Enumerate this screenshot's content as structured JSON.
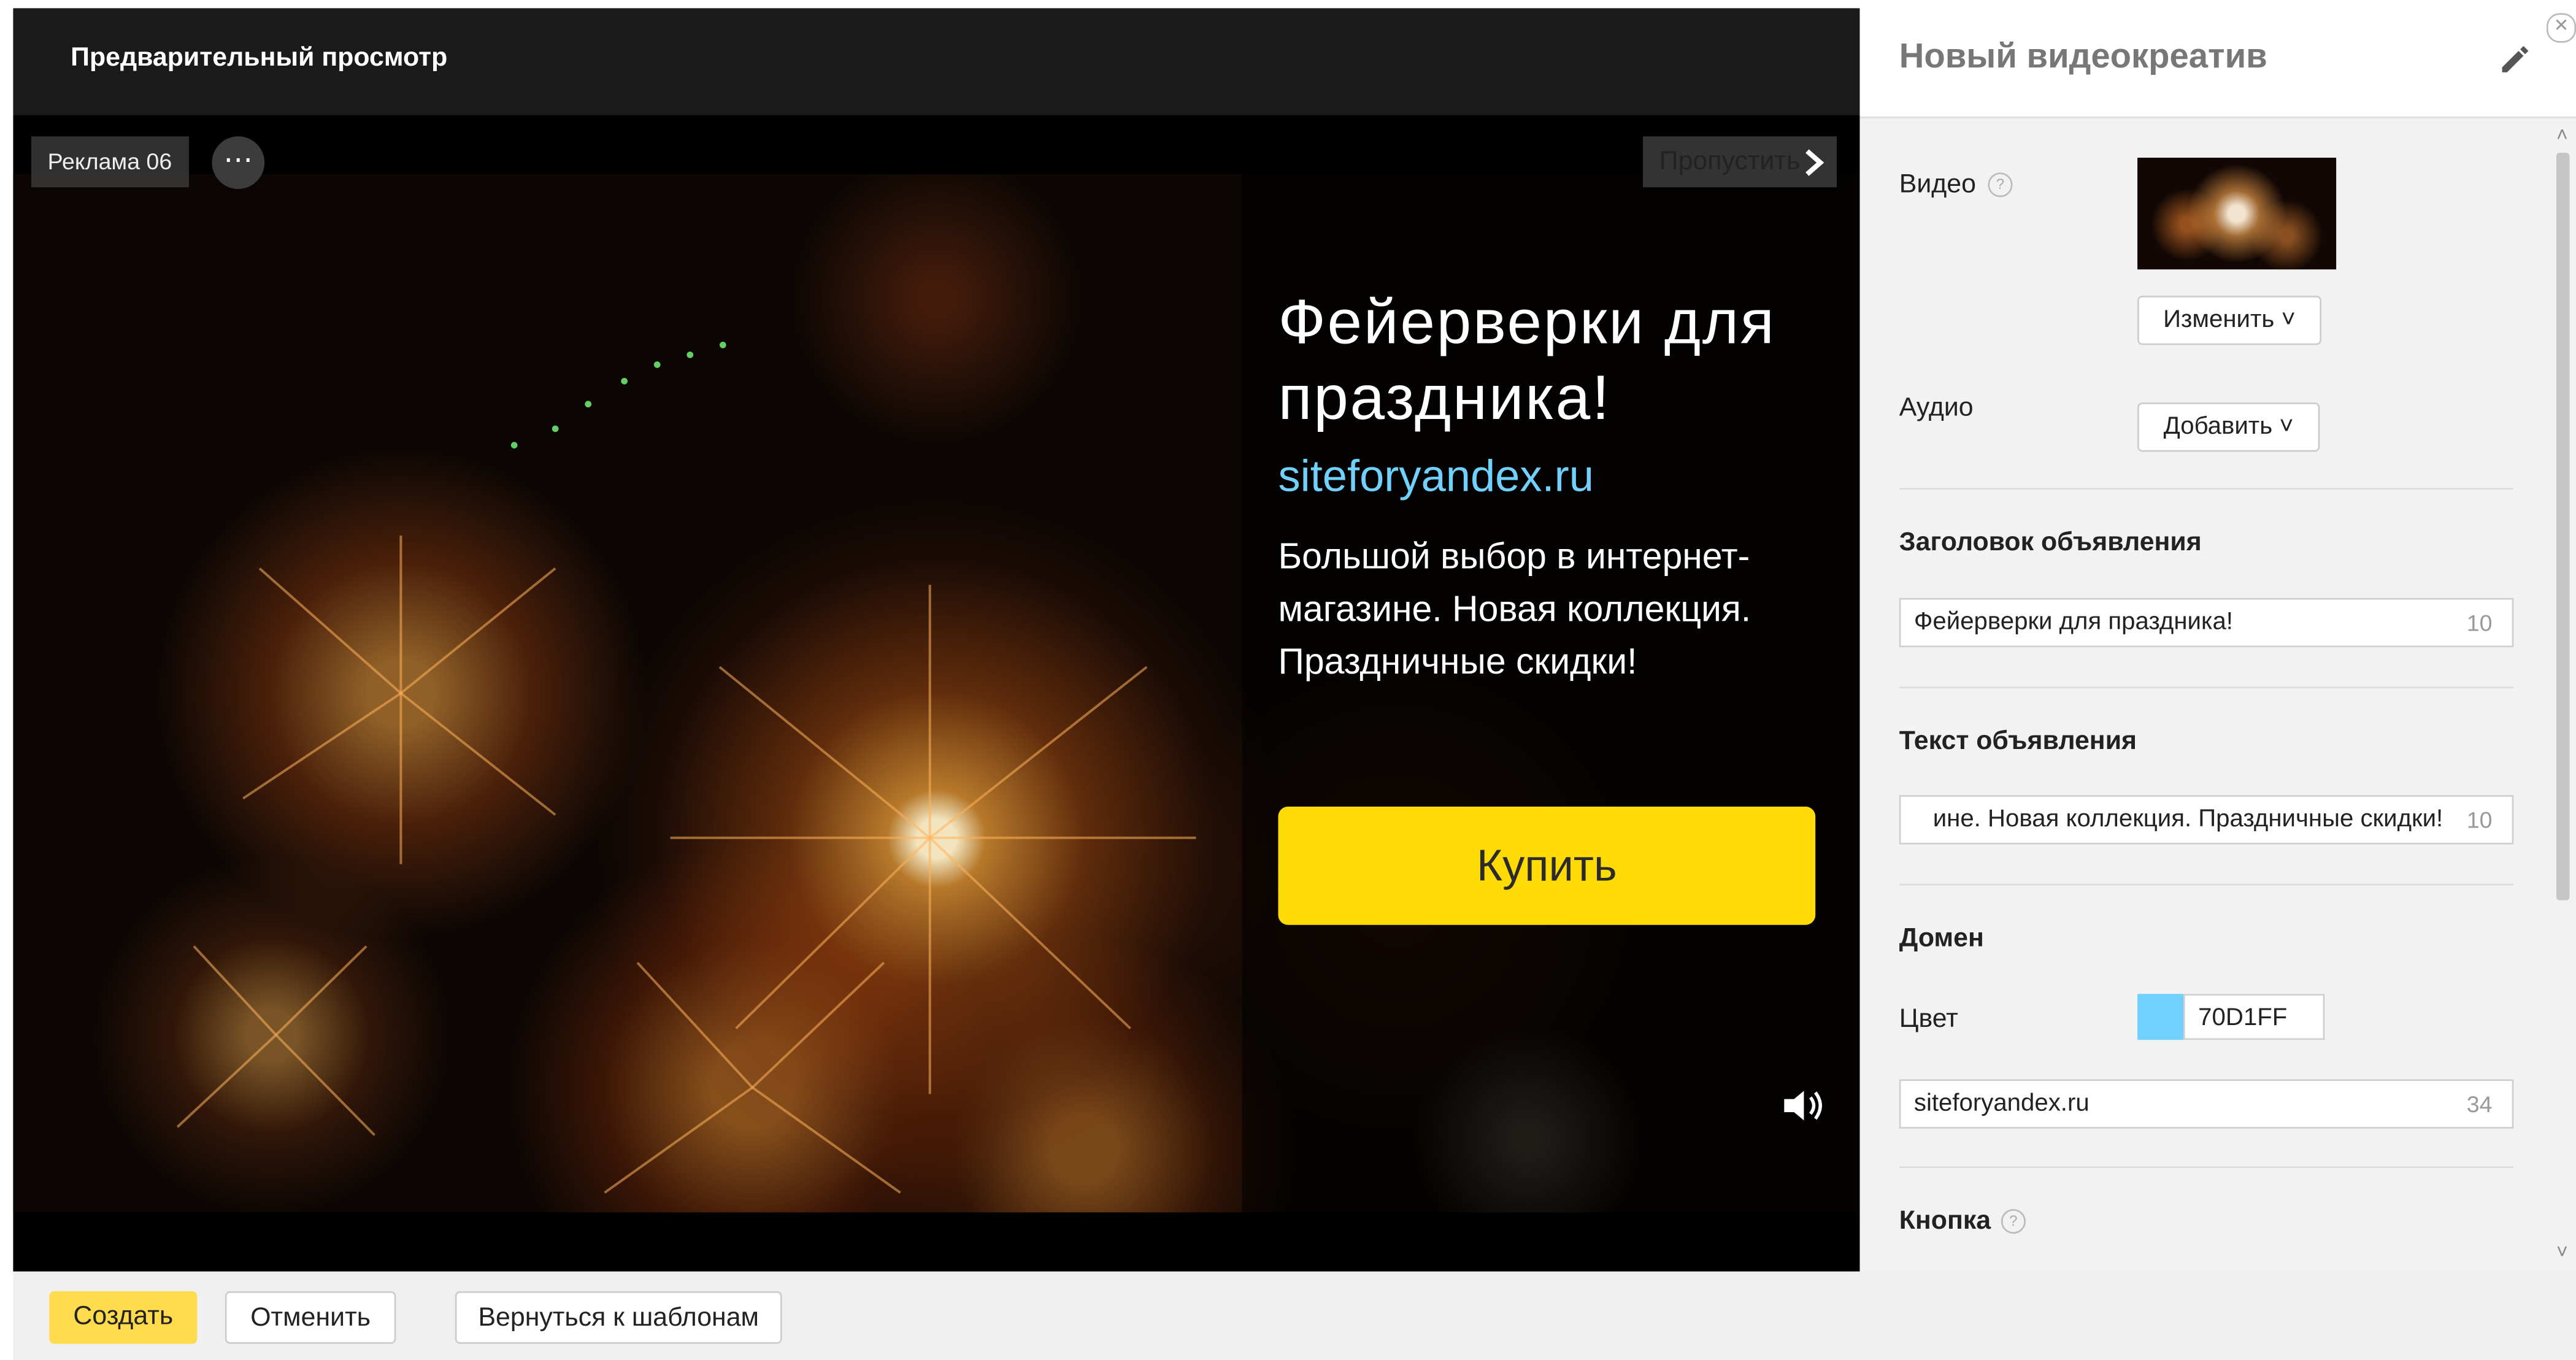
{
  "preview": {
    "header_title": "Предварительный просмотр",
    "ad_badge": "Реклама 06",
    "more_icon": "more-dots-icon",
    "skip_label": "Пропустить",
    "ad_title": "Фейерверки для праздника!",
    "ad_domain": "siteforyandex.ru",
    "ad_text": "Большой выбор в интернет-магазине. Новая коллекция. Праздничные скидки!",
    "buy_button": "Купить",
    "sound_icon": "speaker-icon",
    "colors": {
      "button": "#ffdb05",
      "domain": "#70D1FF"
    }
  },
  "panel": {
    "title": "Новый видеокреатив",
    "video_label": "Видео",
    "change_button": "Изменить",
    "audio_label": "Аудио",
    "add_button": "Добавить",
    "headline_label": "Заголовок объявления",
    "headline_value": "Фейерверки для праздника!",
    "headline_count": "10",
    "text_label": "Текст объявления",
    "text_value": "ине. Новая коллекция. Праздничные скидки!",
    "text_count": "10",
    "domain_label": "Домен",
    "color_label": "Цвет",
    "color_value": "70D1FF",
    "domain_value": "siteforyandex.ru",
    "domain_count": "34",
    "button_label": "Кнопка"
  },
  "footer": {
    "create": "Создать",
    "cancel": "Отменить",
    "back": "Вернуться к шаблонам"
  }
}
